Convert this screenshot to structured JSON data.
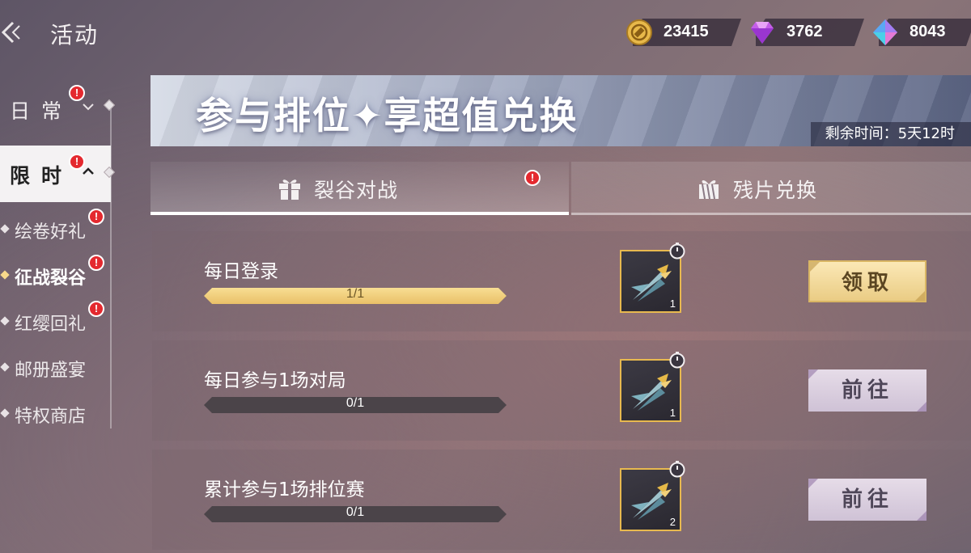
{
  "header": {
    "title": "活动",
    "currencies": [
      {
        "icon": "gold-coin-icon",
        "value": "23415"
      },
      {
        "icon": "pink-diamond-icon",
        "value": "3762"
      },
      {
        "icon": "blue-crystal-icon",
        "value": "8043"
      }
    ]
  },
  "nav": {
    "categories": [
      {
        "label": "日常",
        "badge": "!"
      },
      {
        "label": "限时",
        "badge": "!"
      }
    ],
    "items": [
      {
        "label": "绘卷好礼",
        "badge": "!"
      },
      {
        "label": "征战裂谷",
        "badge": "!"
      },
      {
        "label": "红缨回礼",
        "badge": "!"
      },
      {
        "label": "邮册盛宴"
      },
      {
        "label": "特权商店"
      }
    ]
  },
  "banner": {
    "title": "参与排位✦享超值兑换",
    "time_left": "剩余时间：5天12时"
  },
  "tabs": [
    {
      "label": "裂谷对战",
      "badge": "!"
    },
    {
      "label": "残片兑换"
    }
  ],
  "tasks": [
    {
      "name": "每日登录",
      "progress_text": "1/1",
      "progress": 1.0,
      "reward_count": "1",
      "button": "领取"
    },
    {
      "name": "每日参与1场对局",
      "progress_text": "0/1",
      "progress": 0.0,
      "reward_count": "1",
      "button": "前往"
    },
    {
      "name": "累计参与1场排位赛",
      "progress_text": "0/1",
      "progress": 0.0,
      "reward_count": "2",
      "button": "前往"
    }
  ],
  "colors": {
    "accent_gold": "#e9c068",
    "badge_red": "#e4292f",
    "button_go": "#cfc2d6"
  }
}
